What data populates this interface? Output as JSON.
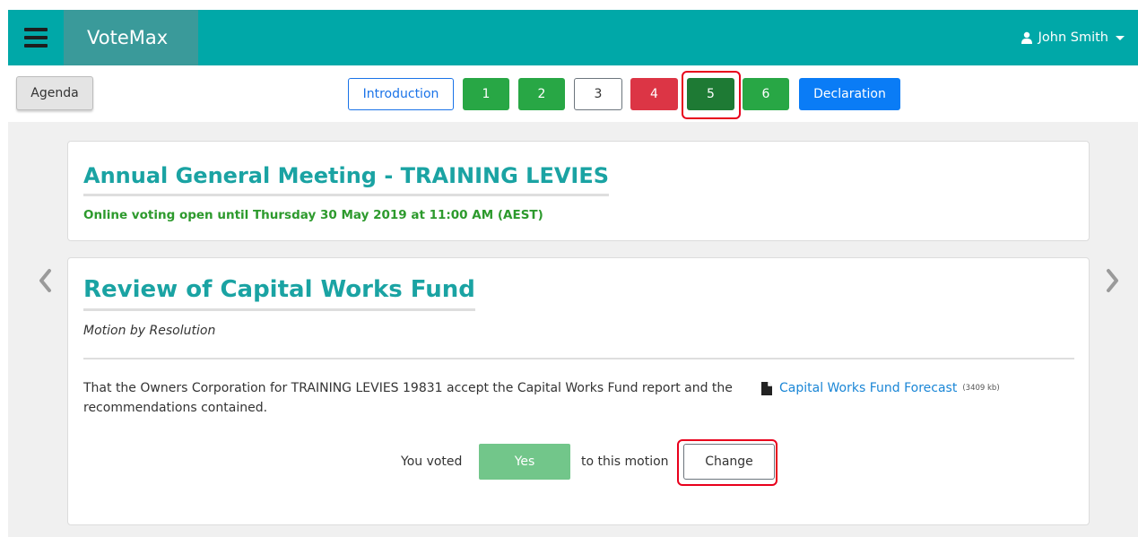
{
  "navbar": {
    "brand": "VoteMax",
    "user_name": "John Smith",
    "background": "#00a8a8"
  },
  "tabbar": {
    "agenda_label": "Agenda",
    "buttons": [
      {
        "label": "Introduction",
        "state": "outline-primary"
      },
      {
        "label": "1",
        "state": "green"
      },
      {
        "label": "2",
        "state": "green"
      },
      {
        "label": "3",
        "state": "white"
      },
      {
        "label": "4",
        "state": "red"
      },
      {
        "label": "5",
        "state": "active-dark-green"
      },
      {
        "label": "6",
        "state": "green"
      },
      {
        "label": "Declaration",
        "state": "blue"
      }
    ]
  },
  "meeting": {
    "title": "Annual General Meeting - TRAINING LEVIES",
    "voting_status": "Online voting open until Thursday 30 May 2019 at 11:00 AM (AEST)"
  },
  "motion": {
    "title": "Review of Capital Works Fund",
    "type": "Motion by Resolution",
    "text": "That the Owners Corporation for TRAINING LEVIES 19831 accept the Capital Works Fund report and the recommendations contained.",
    "document": {
      "name": "Capital Works Fund Forecast",
      "size": "(3409 kb)",
      "icon": "file-icon"
    },
    "vote": {
      "prefix": "You voted",
      "value": "Yes",
      "suffix": "to this motion",
      "change_label": "Change"
    }
  },
  "colors": {
    "accent": "#1aa3a3",
    "green": "#28a745",
    "dark_green": "#1e7a34",
    "red": "#dc3545",
    "blue": "#0a7cf6",
    "highlight": "#e8001c"
  }
}
